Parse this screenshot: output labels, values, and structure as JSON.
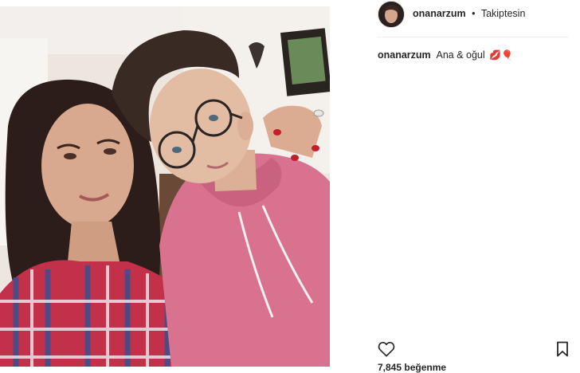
{
  "post": {
    "username": "onanarzum",
    "follow_status": "Takiptesin",
    "separator": "•",
    "caption_text": "Ana & oğul",
    "caption_emoji": "💋🎈",
    "likes_text": "7,845 beğenme"
  },
  "icons": {
    "like": "heart-outline-icon",
    "save": "bookmark-outline-icon"
  },
  "colors": {
    "text": "#262626",
    "divider": "#efefef",
    "hoodie": "#d9728e",
    "plaid_red": "#c2304a",
    "plaid_blue": "#3d4f8f"
  }
}
